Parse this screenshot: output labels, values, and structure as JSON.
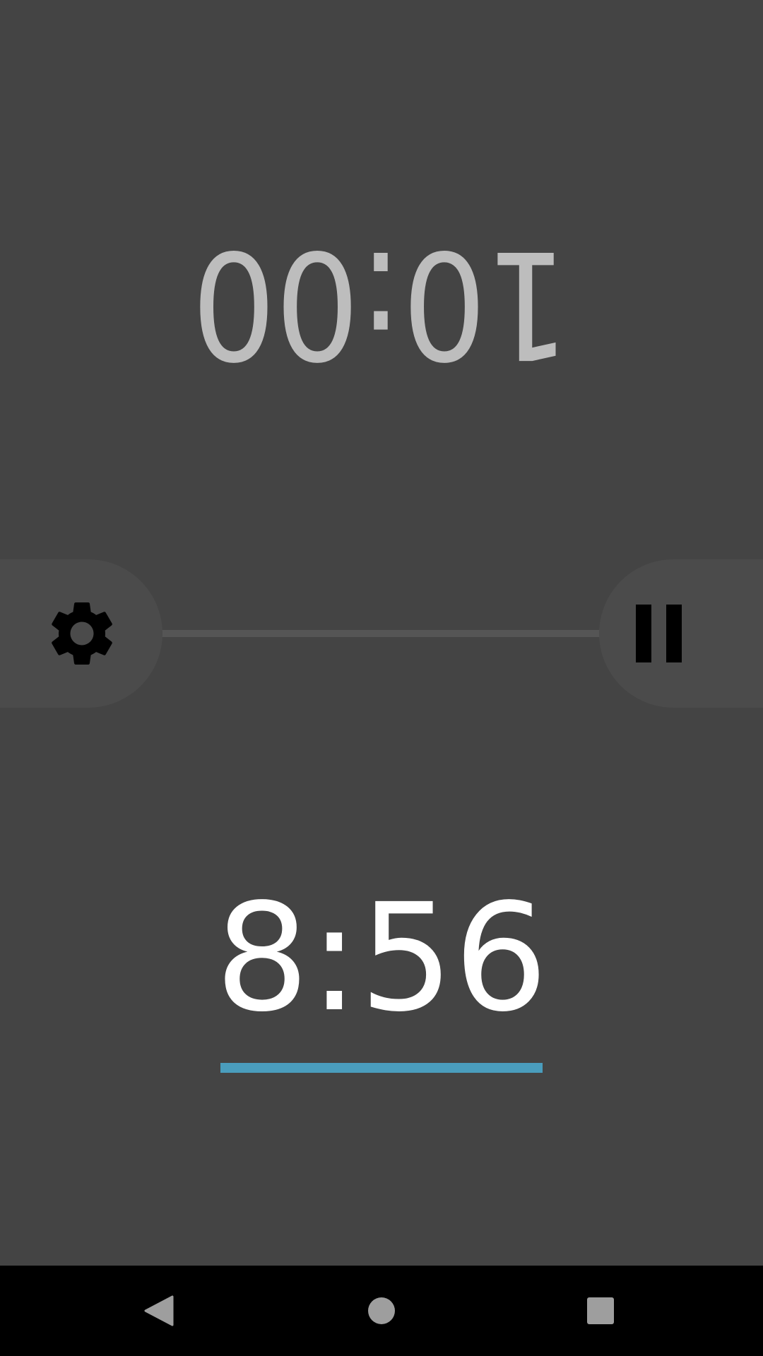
{
  "players": {
    "top": {
      "time": "10:00"
    },
    "bottom": {
      "time": "8:56",
      "progress": 1.0
    }
  },
  "controls": {
    "settings_icon": "gear-icon",
    "pause_icon": "pause-icon"
  },
  "navbar": {
    "back_icon": "back-triangle-icon",
    "home_icon": "home-circle-icon",
    "recents_icon": "recents-square-icon"
  },
  "colors": {
    "background": "#444444",
    "top_clock_text": "#bdbdbd",
    "bottom_clock_text": "#ffffff",
    "progress": "#4a9dbd",
    "button_bg": "#4b4b4b"
  }
}
